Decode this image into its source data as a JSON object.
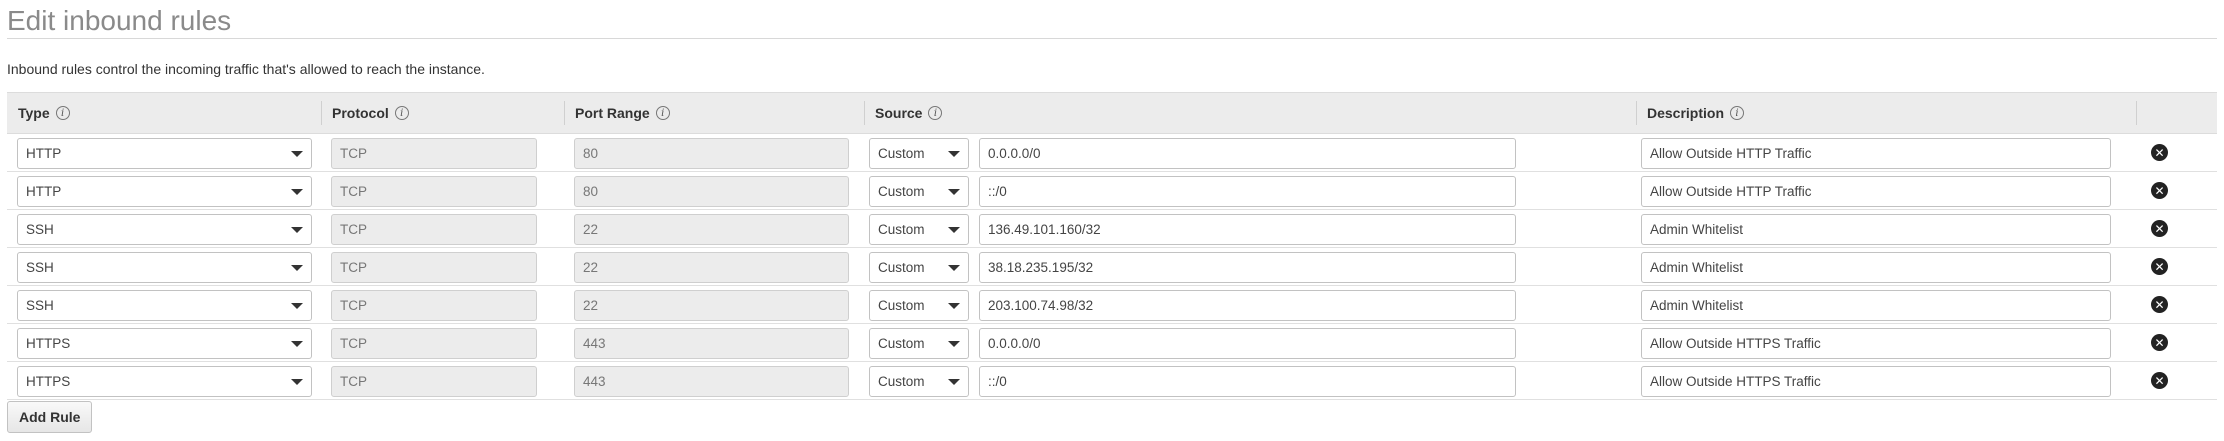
{
  "page": {
    "title": "Edit inbound rules",
    "intro": "Inbound rules control the incoming traffic that's allowed to reach the instance."
  },
  "columns": {
    "type": "Type",
    "protocol": "Protocol",
    "port_range": "Port Range",
    "source": "Source",
    "description": "Description"
  },
  "rules": [
    {
      "type": "HTTP",
      "protocol": "TCP",
      "port": "80",
      "source_mode": "Custom",
      "source": "0.0.0.0/0",
      "description": "Allow Outside HTTP Traffic"
    },
    {
      "type": "HTTP",
      "protocol": "TCP",
      "port": "80",
      "source_mode": "Custom",
      "source": "::/0",
      "description": "Allow Outside HTTP Traffic"
    },
    {
      "type": "SSH",
      "protocol": "TCP",
      "port": "22",
      "source_mode": "Custom",
      "source": "136.49.101.160/32",
      "description": "Admin Whitelist"
    },
    {
      "type": "SSH",
      "protocol": "TCP",
      "port": "22",
      "source_mode": "Custom",
      "source": "38.18.235.195/32",
      "description": "Admin Whitelist"
    },
    {
      "type": "SSH",
      "protocol": "TCP",
      "port": "22",
      "source_mode": "Custom",
      "source": "203.100.74.98/32",
      "description": "Admin Whitelist"
    },
    {
      "type": "HTTPS",
      "protocol": "TCP",
      "port": "443",
      "source_mode": "Custom",
      "source": "0.0.0.0/0",
      "description": "Allow Outside HTTPS Traffic"
    },
    {
      "type": "HTTPS",
      "protocol": "TCP",
      "port": "443",
      "source_mode": "Custom",
      "source": "::/0",
      "description": "Allow Outside HTTPS Traffic"
    }
  ],
  "actions": {
    "add_rule": "Add Rule",
    "delete_glyph": "✕"
  },
  "icons": {
    "info": "info-icon",
    "dropdown": "chevron-down-icon",
    "delete": "close-circle-icon"
  }
}
